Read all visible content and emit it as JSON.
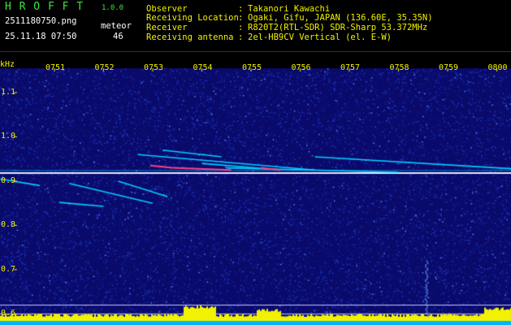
{
  "header": {
    "app_title": "H R O F F T",
    "version": "1.0.0",
    "filename": "2511180750.png",
    "category": "meteor",
    "datetime": "25.11.18 07:50",
    "count": "46",
    "info_rows": [
      {
        "label": "Observer",
        "sep": ":",
        "value": "Takanori Kawachi"
      },
      {
        "label": "Receiving Location",
        "sep": ":",
        "value": "Ogaki, Gifu, JAPAN (136.60E, 35.35N)"
      },
      {
        "label": "Receiver",
        "sep": ":",
        "value": "R820T2(RTL-SDR) SDR-Sharp 53.372MHz"
      },
      {
        "label": "Receiving antenna",
        "sep": ":",
        "value": "2el-HB9CV Vertical (el. E-W)"
      }
    ]
  },
  "plot": {
    "y_unit": "kHz",
    "y_ticks": [
      "1.1",
      "1.0",
      "0.9",
      "0.8",
      "0.7",
      "0.6"
    ],
    "y_range": [
      0.575,
      1.155
    ],
    "x_ticks": [
      "0751",
      "0752",
      "0753",
      "0754",
      "0755",
      "0756",
      "0757",
      "0758",
      "0759",
      "0800"
    ],
    "colors": {
      "background": "#0a0a6a",
      "noise": "#1e3cc8",
      "carrier": "#e8e8ff",
      "trail": "#00d0ff",
      "trail_hot": "#ff4080",
      "power_bar": "#f2f200",
      "power_base": "#00b4ff",
      "text": "#f2f200"
    }
  }
}
